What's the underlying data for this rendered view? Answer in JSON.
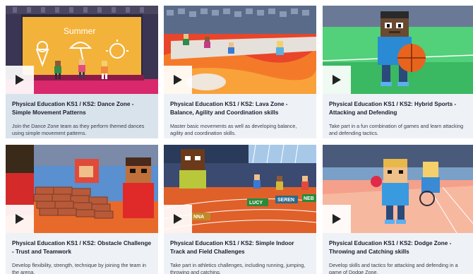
{
  "cards": [
    {
      "title": "Physical Education KS1 / KS2: Dance Zone - Simple Movement Patterns",
      "description": "Join the Dance Zone team as they perform themed dances using simple movement patterns.",
      "sign_text": "Summer",
      "thumbnail": "dance-stage-illustration"
    },
    {
      "title": "Physical Education KS1 / KS2: Lava Zone - Balance, Agility and Coordination skills",
      "description": "Master basic movements as well as developing balance, agility and coordination skills.",
      "thumbnail": "lava-zone-illustration"
    },
    {
      "title": "Physical Education KS1 / KS2: Hybrid Sports - Attacking and Defending",
      "description": "Take part in a fun combination of games and learn attacking and defending tactics.",
      "thumbnail": "hybrid-sports-illustration"
    },
    {
      "title": "Physical Education KS1 / KS2: Obstacle Challenge - Trust and Teamwork",
      "description": "Develop flexibility, strength, technique by joining the team in the arena.",
      "thumbnail": "obstacle-wall-illustration"
    },
    {
      "title": "Physical Education KS1 / KS2: Simple Indoor Track and Field Challenges",
      "description": "Take part in athletics challenges, including running, jumping, throwing and catching.",
      "labels": [
        "LUCY",
        "SEREN",
        "NEB",
        "NNA"
      ],
      "thumbnail": "indoor-track-illustration"
    },
    {
      "title": "Physical Education KS1 / KS2: Dodge Zone - Throwing and Catching skills",
      "description": "Develop skills and tactics for attacking and defending in a game of Dodge Zone.",
      "thumbnail": "dodge-zone-illustration"
    }
  ],
  "colors": {
    "card_background": "#eef2f6",
    "card_background_selected": "#d9e3ec",
    "title_text": "#1b1b2f",
    "description_text": "#3a3a4a"
  },
  "icons": {
    "play": "play-icon"
  }
}
